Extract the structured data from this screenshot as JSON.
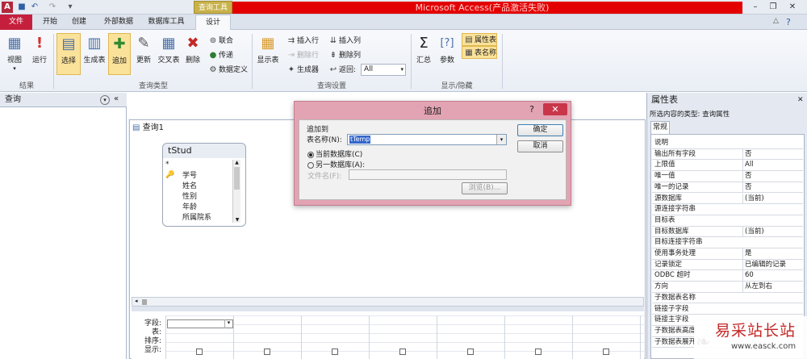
{
  "titlebar": {
    "app_title": "Microsoft Access(产品激活失败)",
    "context_tab": "查询工具"
  },
  "tabs": [
    {
      "label": "文件"
    },
    {
      "label": "开始"
    },
    {
      "label": "创建"
    },
    {
      "label": "外部数据"
    },
    {
      "label": "数据库工具"
    },
    {
      "label": "设计"
    }
  ],
  "ribbon": {
    "results": {
      "label": "结果",
      "view": "视图",
      "run": "运行"
    },
    "query_type": {
      "label": "查询类型",
      "select": "选择",
      "make_table": "生成表",
      "append": "追加",
      "update": "更新",
      "crosstab": "交叉表",
      "delete": "删除",
      "union": "联合",
      "pass_through": "传递",
      "data_definition": "数据定义"
    },
    "query_setup": {
      "label": "查询设置",
      "show_table": "显示表",
      "insert_rows": "插入行",
      "delete_rows": "删除行",
      "builder": "生成器",
      "insert_columns": "插入列",
      "delete_columns": "删除列",
      "return_label": "返回:",
      "return_value": "All"
    },
    "show_hide": {
      "label": "显示/隐藏",
      "totals": "汇总",
      "parameters": "参数",
      "property_sheet": "属性表",
      "table_names": "表名称"
    }
  },
  "nav": {
    "title": "查询"
  },
  "query": {
    "tab_label": "查询1",
    "table": {
      "name": "tStud",
      "fields": [
        "*",
        "学号",
        "姓名",
        "性别",
        "年龄",
        "所属院系"
      ]
    },
    "grid_labels": [
      "字段:",
      "表:",
      "排序:",
      "显示:"
    ]
  },
  "dialog": {
    "title": "追加",
    "group_label": "追加到",
    "table_name_label": "表名称(N):",
    "table_name_value": "tTemp",
    "current_db": "当前数据库(C)",
    "other_db": "另一数据库(A):",
    "file_name_label": "文件名(F):",
    "browse": "浏览(B)...",
    "ok": "确定",
    "cancel": "取消",
    "help": "?"
  },
  "property_sheet": {
    "title": "属性表",
    "selection_type": "所选内容的类型: 查询属性",
    "tab": "常规",
    "rows": [
      {
        "k": "说明",
        "v": ""
      },
      {
        "k": "输出所有字段",
        "v": "否"
      },
      {
        "k": "上限值",
        "v": "All"
      },
      {
        "k": "唯一值",
        "v": "否"
      },
      {
        "k": "唯一的记录",
        "v": "否"
      },
      {
        "k": "源数据库",
        "v": "(当前)"
      },
      {
        "k": "源连接字符串",
        "v": ""
      },
      {
        "k": "目标表",
        "v": ""
      },
      {
        "k": "目标数据库",
        "v": "(当前)"
      },
      {
        "k": "目标连接字符串",
        "v": ""
      },
      {
        "k": "使用事务处理",
        "v": "是"
      },
      {
        "k": "记录锁定",
        "v": "已编辑的记录"
      },
      {
        "k": "ODBC 超时",
        "v": "60"
      },
      {
        "k": "方向",
        "v": "从左到右"
      },
      {
        "k": "子数据表名称",
        "v": ""
      },
      {
        "k": "链接子字段",
        "v": ""
      },
      {
        "k": "链接主字段",
        "v": ""
      },
      {
        "k": "子数据表高度",
        "v": ""
      },
      {
        "k": "子数据表展开",
        "v": ""
      }
    ]
  },
  "watermark": {
    "text": "易采站长站",
    "url": "www.easck.com"
  }
}
